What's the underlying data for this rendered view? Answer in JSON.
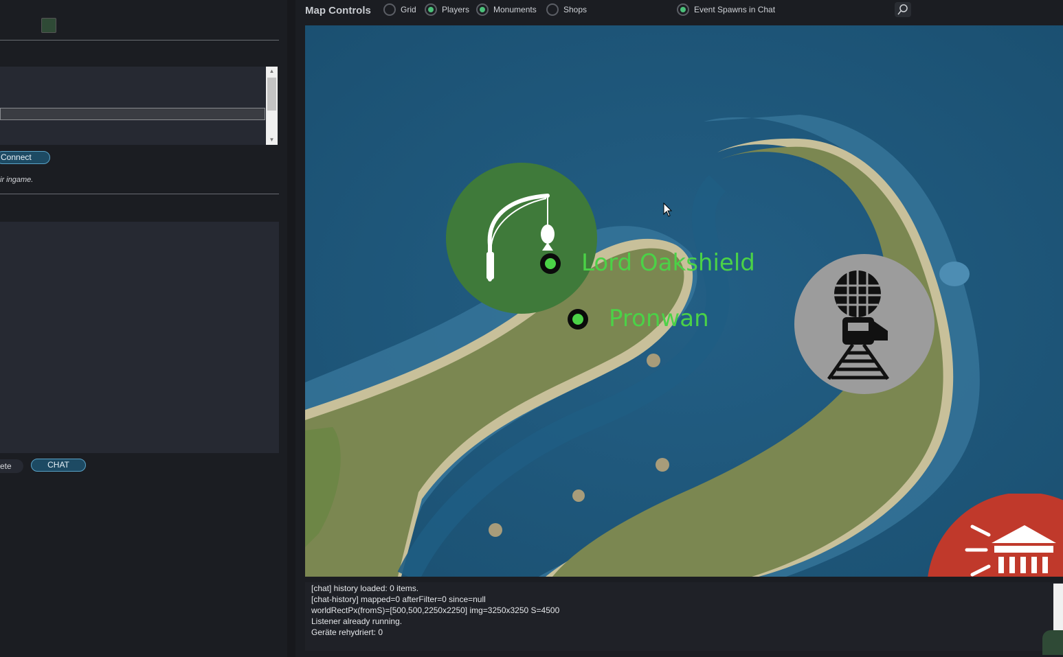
{
  "left_panel": {
    "connect_button": "Connect",
    "hint_text": "ir ingame.",
    "partial_button": "ete",
    "chat_button": "CHAT"
  },
  "map_controls": {
    "title": "Map Controls",
    "options": [
      {
        "label": "Grid",
        "checked": false
      },
      {
        "label": "Players",
        "checked": true
      },
      {
        "label": "Monuments",
        "checked": true
      },
      {
        "label": "Shops",
        "checked": false
      }
    ],
    "event_spawns": {
      "label": "Event Spawns in Chat",
      "checked": true
    }
  },
  "map": {
    "players": [
      {
        "name": "Lord Oakshield"
      },
      {
        "name": "Pronwan"
      }
    ],
    "monuments": [
      {
        "icon": "fishing-village-icon"
      },
      {
        "icon": "train-station-icon"
      },
      {
        "icon": "monument-red-icon"
      }
    ],
    "colors": {
      "water": "#1f5d83",
      "land": "#7b8751",
      "player": "#4bd247"
    }
  },
  "log": {
    "lines": [
      "[chat] history loaded: 0 items.",
      "[chat-history] mapped=0 afterFilter=0 since=null",
      "worldRectPx(fromS)=[500,500,2250x2250] img=3250x3250 S=4500",
      "Listener already running.",
      "Geräte rehydriert: 0"
    ]
  }
}
